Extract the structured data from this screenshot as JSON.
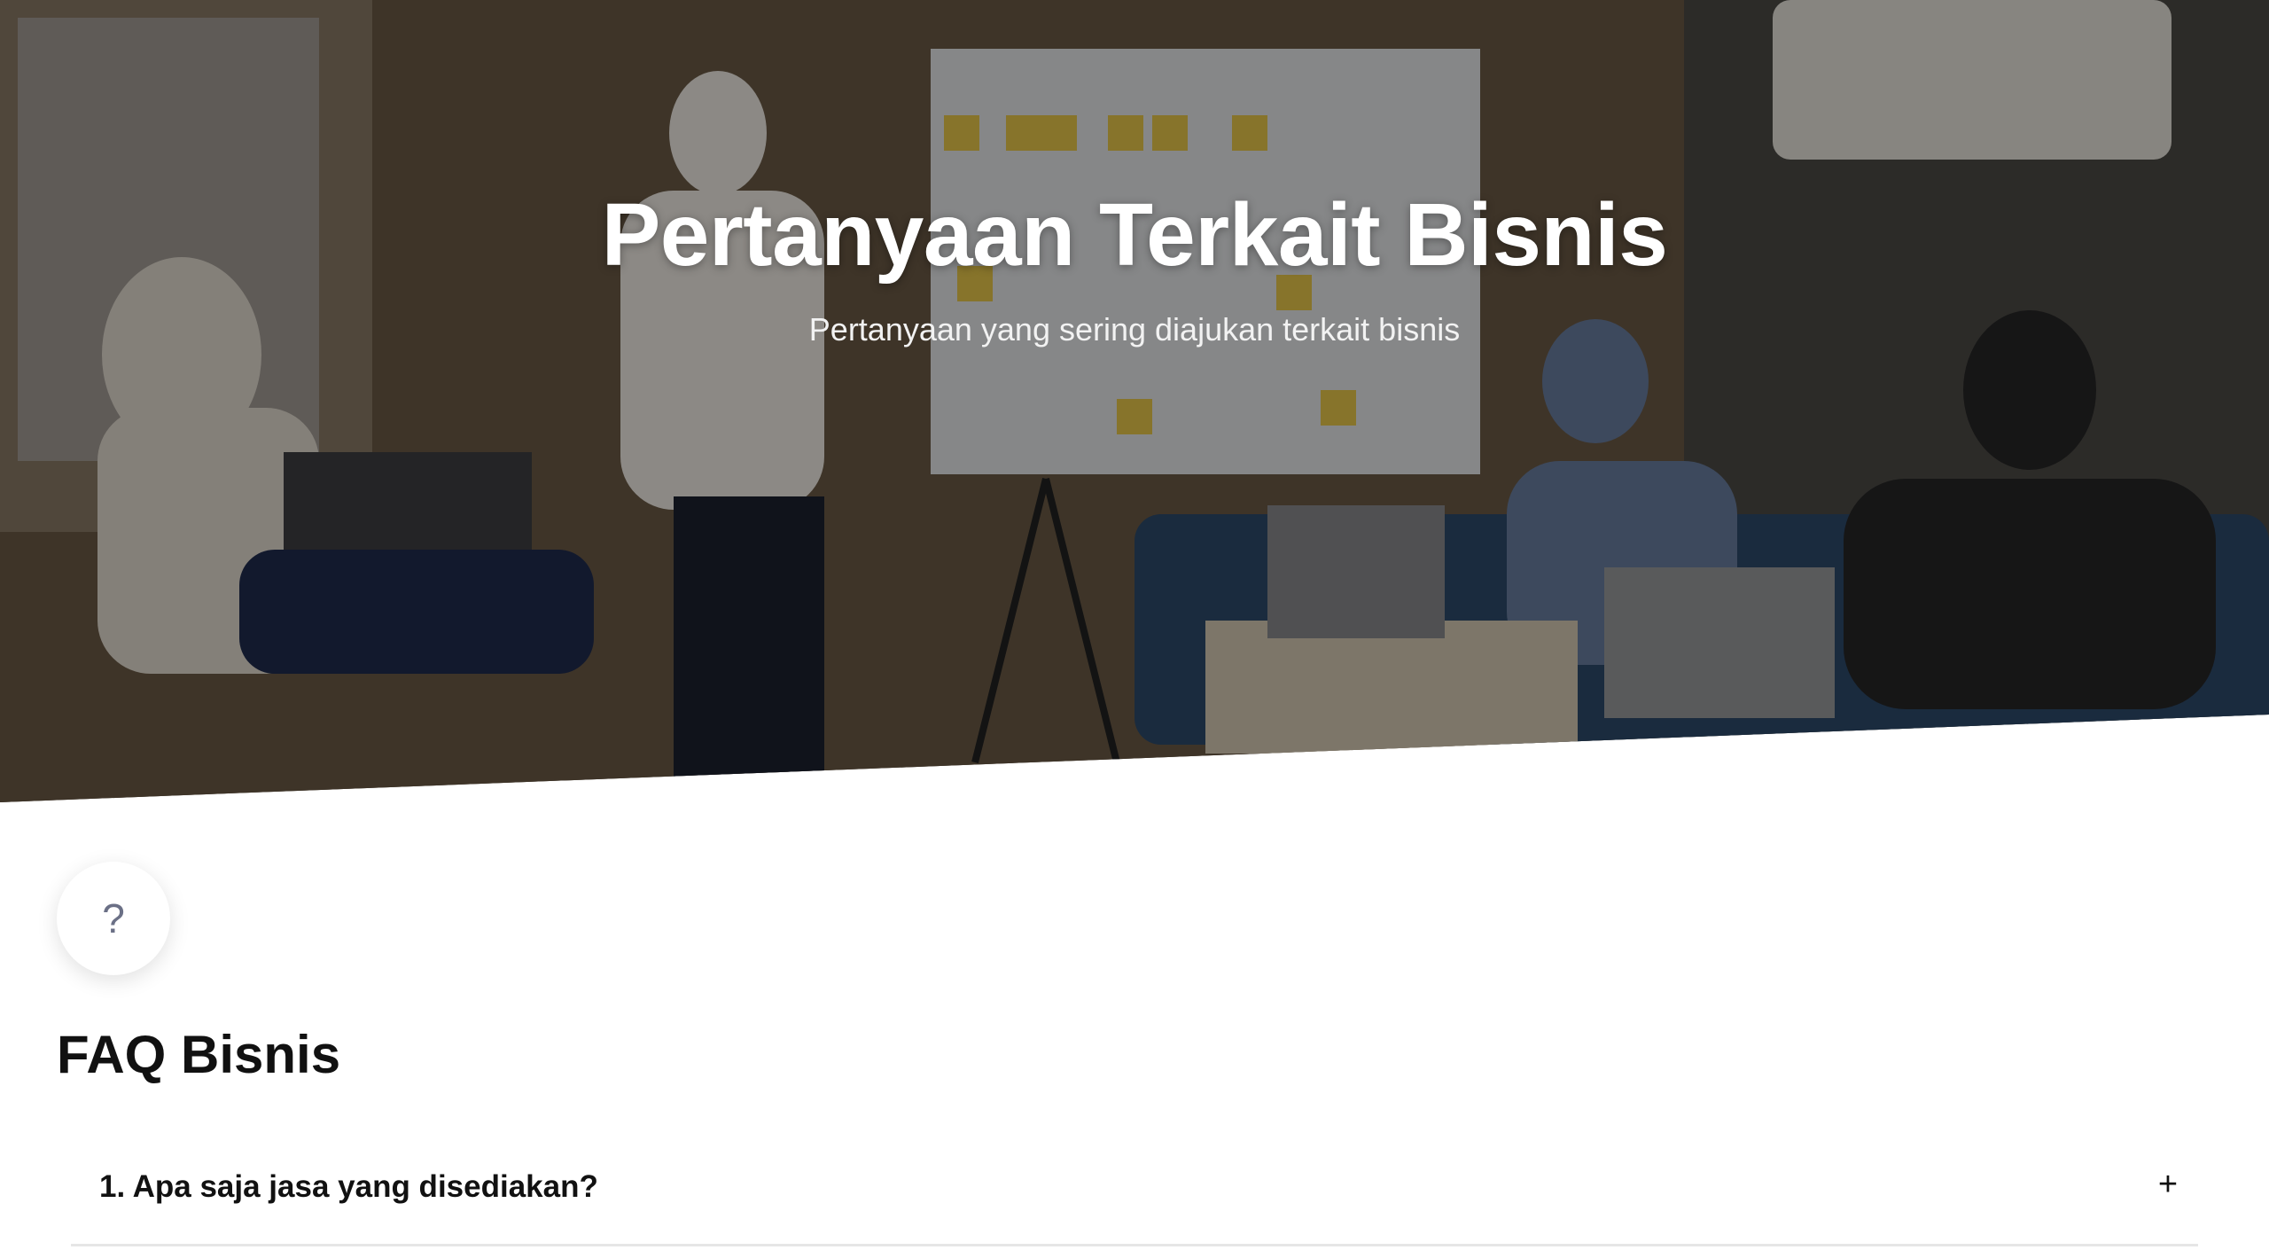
{
  "hero": {
    "title": "Pertanyaan Terkait Bisnis",
    "subtitle": "Pertanyaan yang sering diajukan terkait bisnis",
    "image": "team-meeting-whiteboard-photo"
  },
  "faq": {
    "icon": "question-mark-icon",
    "icon_glyph": "?",
    "heading": "FAQ Bisnis",
    "items": [
      {
        "question": "1. Apa saja jasa yang disediakan?",
        "toggle": "+",
        "expanded": false
      }
    ]
  },
  "colors": {
    "heading": "#111111",
    "icon": "#6b7086",
    "divider": "#e6e6e6"
  }
}
